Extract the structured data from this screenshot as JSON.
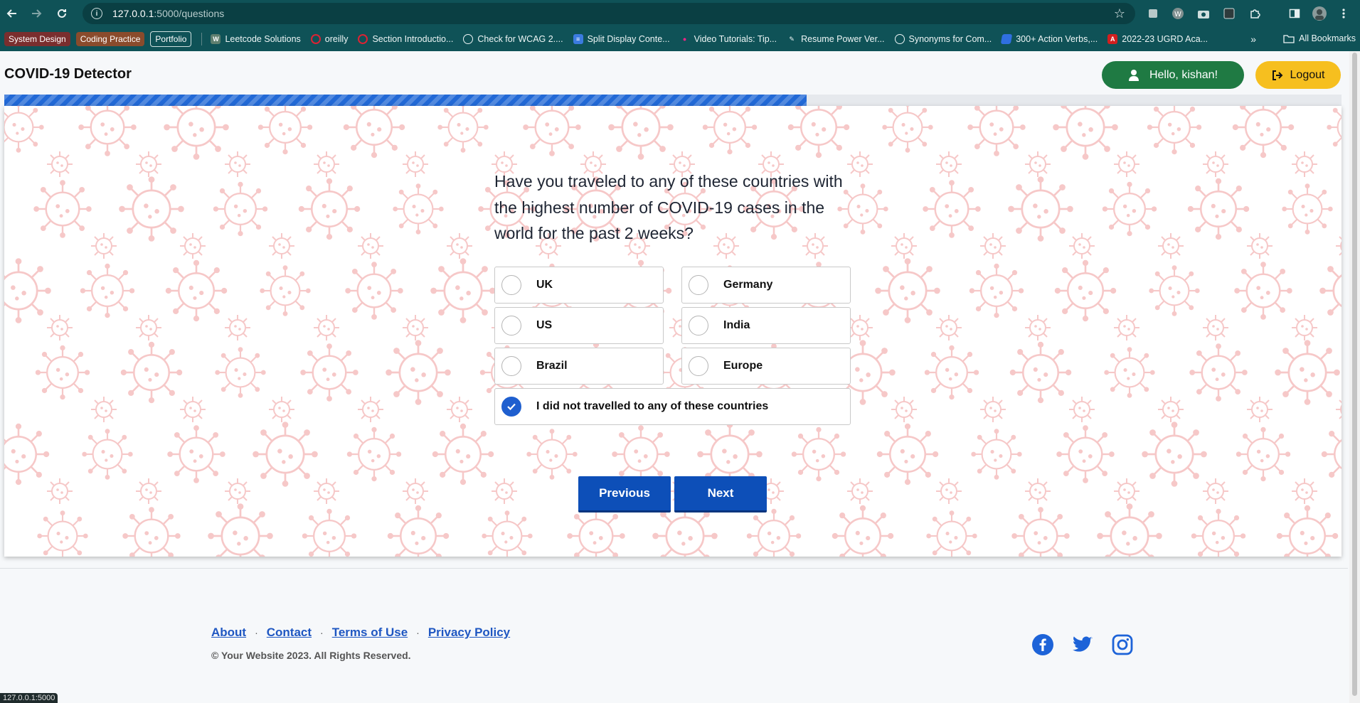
{
  "browser": {
    "url_host": "127.0.0.1",
    "url_path": ":5000/questions",
    "status_url": "127.0.0.1:5000",
    "bookmarks_chips": [
      "System Design",
      "Coding Practice",
      "Portfolio"
    ],
    "bookmarks": [
      {
        "label": "Leetcode Solutions",
        "icon": "w-icon"
      },
      {
        "label": "oreilly",
        "icon": "oreilly-icon"
      },
      {
        "label": "Section Introductio...",
        "icon": "oreilly-icon"
      },
      {
        "label": "Check for WCAG 2....",
        "icon": "globe-icon"
      },
      {
        "label": "Split Display Conte...",
        "icon": "doc-icon"
      },
      {
        "label": "Video Tutorials: Tip...",
        "icon": "people-icon"
      },
      {
        "label": "Resume Power Ver...",
        "icon": "pencil-icon"
      },
      {
        "label": "Synonyms for Com...",
        "icon": "globe-icon"
      },
      {
        "label": "300+ Action Verbs,...",
        "icon": "blue-icon"
      },
      {
        "label": "2022-23 UGRD Aca...",
        "icon": "pdf-icon"
      }
    ],
    "more": "»",
    "all_bookmarks": "All Bookmarks"
  },
  "header": {
    "title": "COVID-19 Detector",
    "hello_label": "Hello, kishan!",
    "logout_label": "Logout"
  },
  "progress": {
    "value": 0.6
  },
  "question": {
    "text": "Have you traveled to any of these countries with the highest number of COVID-19 cases in the world for the past 2 weeks?",
    "options": [
      {
        "label": "UK",
        "checked": false
      },
      {
        "label": "Germany",
        "checked": false
      },
      {
        "label": "US",
        "checked": false
      },
      {
        "label": "India",
        "checked": false
      },
      {
        "label": "Brazil",
        "checked": false
      },
      {
        "label": "Europe",
        "checked": false
      },
      {
        "label": "I did not travelled to any of these countries",
        "checked": true
      }
    ]
  },
  "nav": {
    "previous": "Previous",
    "next": "Next"
  },
  "footer": {
    "links": [
      "About",
      "Contact",
      "Terms of Use",
      "Privacy Policy"
    ],
    "separator": "·",
    "copyright": "© Your Website 2023. All Rights Reserved.",
    "social": [
      "facebook-icon",
      "twitter-icon",
      "instagram-icon"
    ]
  },
  "colors": {
    "accent": "#0d4fb8",
    "hello_bg": "#1f7a43",
    "logout_bg": "#f6bf1f",
    "progress": "#2269d6",
    "virus_pattern": "#f6c8c8"
  }
}
